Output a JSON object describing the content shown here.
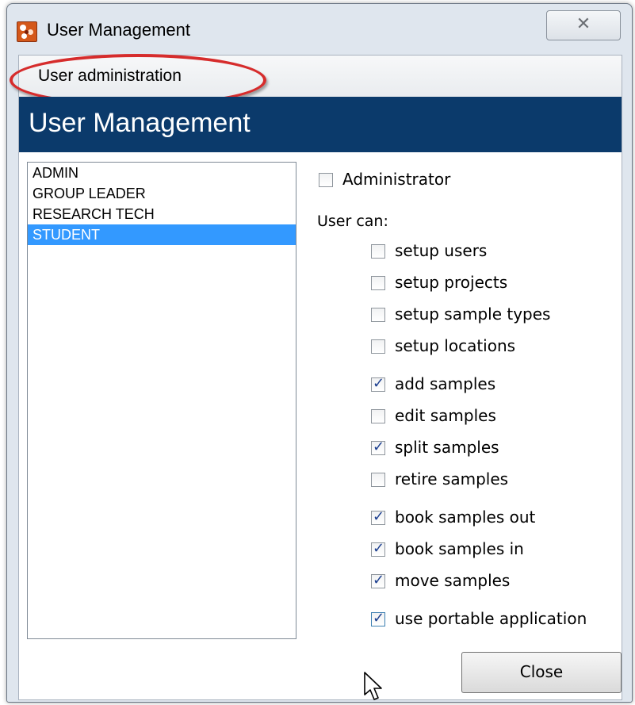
{
  "window": {
    "title": "User Management",
    "close_glyph": "✕"
  },
  "menu": {
    "items": [
      "User administration"
    ],
    "highlight_color": "#d62c2c"
  },
  "header": {
    "title": "User Management",
    "background": "#0b3a6b"
  },
  "users": {
    "items": [
      "ADMIN",
      "GROUP LEADER",
      "RESEARCH TECH",
      "STUDENT"
    ],
    "selected": "STUDENT",
    "selection_color": "#3399ff"
  },
  "permissions": {
    "administrator": {
      "label": "Administrator",
      "checked": false
    },
    "user_can_label": "User can:",
    "items": [
      {
        "label": "setup users",
        "checked": false
      },
      {
        "label": "setup projects",
        "checked": false
      },
      {
        "label": "setup sample types",
        "checked": false
      },
      {
        "label": "setup locations",
        "checked": false
      },
      {
        "label": "add samples",
        "checked": true
      },
      {
        "label": "edit samples",
        "checked": false
      },
      {
        "label": "split samples",
        "checked": true
      },
      {
        "label": "retire samples",
        "checked": false
      },
      {
        "label": "book samples out",
        "checked": true
      },
      {
        "label": "book samples in",
        "checked": true
      },
      {
        "label": "move samples",
        "checked": true
      },
      {
        "label": "use portable application",
        "checked": true
      }
    ],
    "check_glyph": "✓"
  },
  "footer": {
    "close_label": "Close"
  }
}
